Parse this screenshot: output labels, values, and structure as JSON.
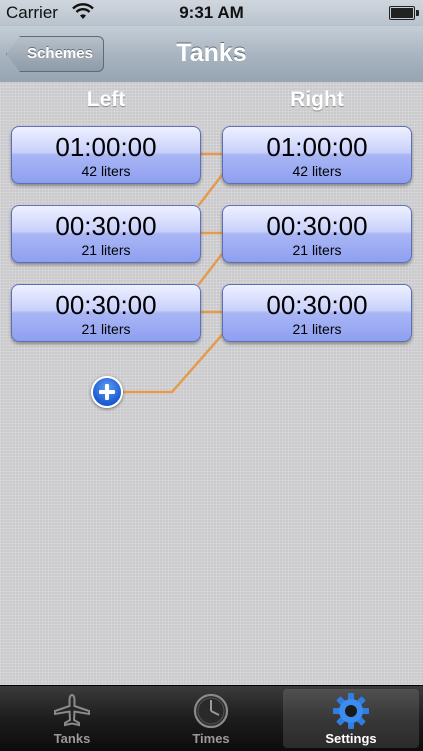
{
  "status_bar": {
    "carrier": "Carrier",
    "time": "9:31 AM"
  },
  "nav": {
    "back_label": "Schemes",
    "title": "Tanks"
  },
  "columns": {
    "left_header": "Left",
    "right_header": "Right"
  },
  "tanks": {
    "left": [
      {
        "time": "01:00:00",
        "volume": "42 liters"
      },
      {
        "time": "00:30:00",
        "volume": "21 liters"
      },
      {
        "time": "00:30:00",
        "volume": "21 liters"
      }
    ],
    "right": [
      {
        "time": "01:00:00",
        "volume": "42 liters"
      },
      {
        "time": "00:30:00",
        "volume": "21 liters"
      },
      {
        "time": "00:30:00",
        "volume": "21 liters"
      }
    ]
  },
  "tabbar": {
    "items": [
      {
        "label": "Tanks",
        "icon": "airplane-icon",
        "active": false
      },
      {
        "label": "Times",
        "icon": "clock-icon",
        "active": false
      },
      {
        "label": "Settings",
        "icon": "gear-icon",
        "active": true
      }
    ]
  },
  "colors": {
    "connector": "#e59b4f",
    "tank_border": "#5d6fb8",
    "add_button": "#1b5ad0"
  }
}
